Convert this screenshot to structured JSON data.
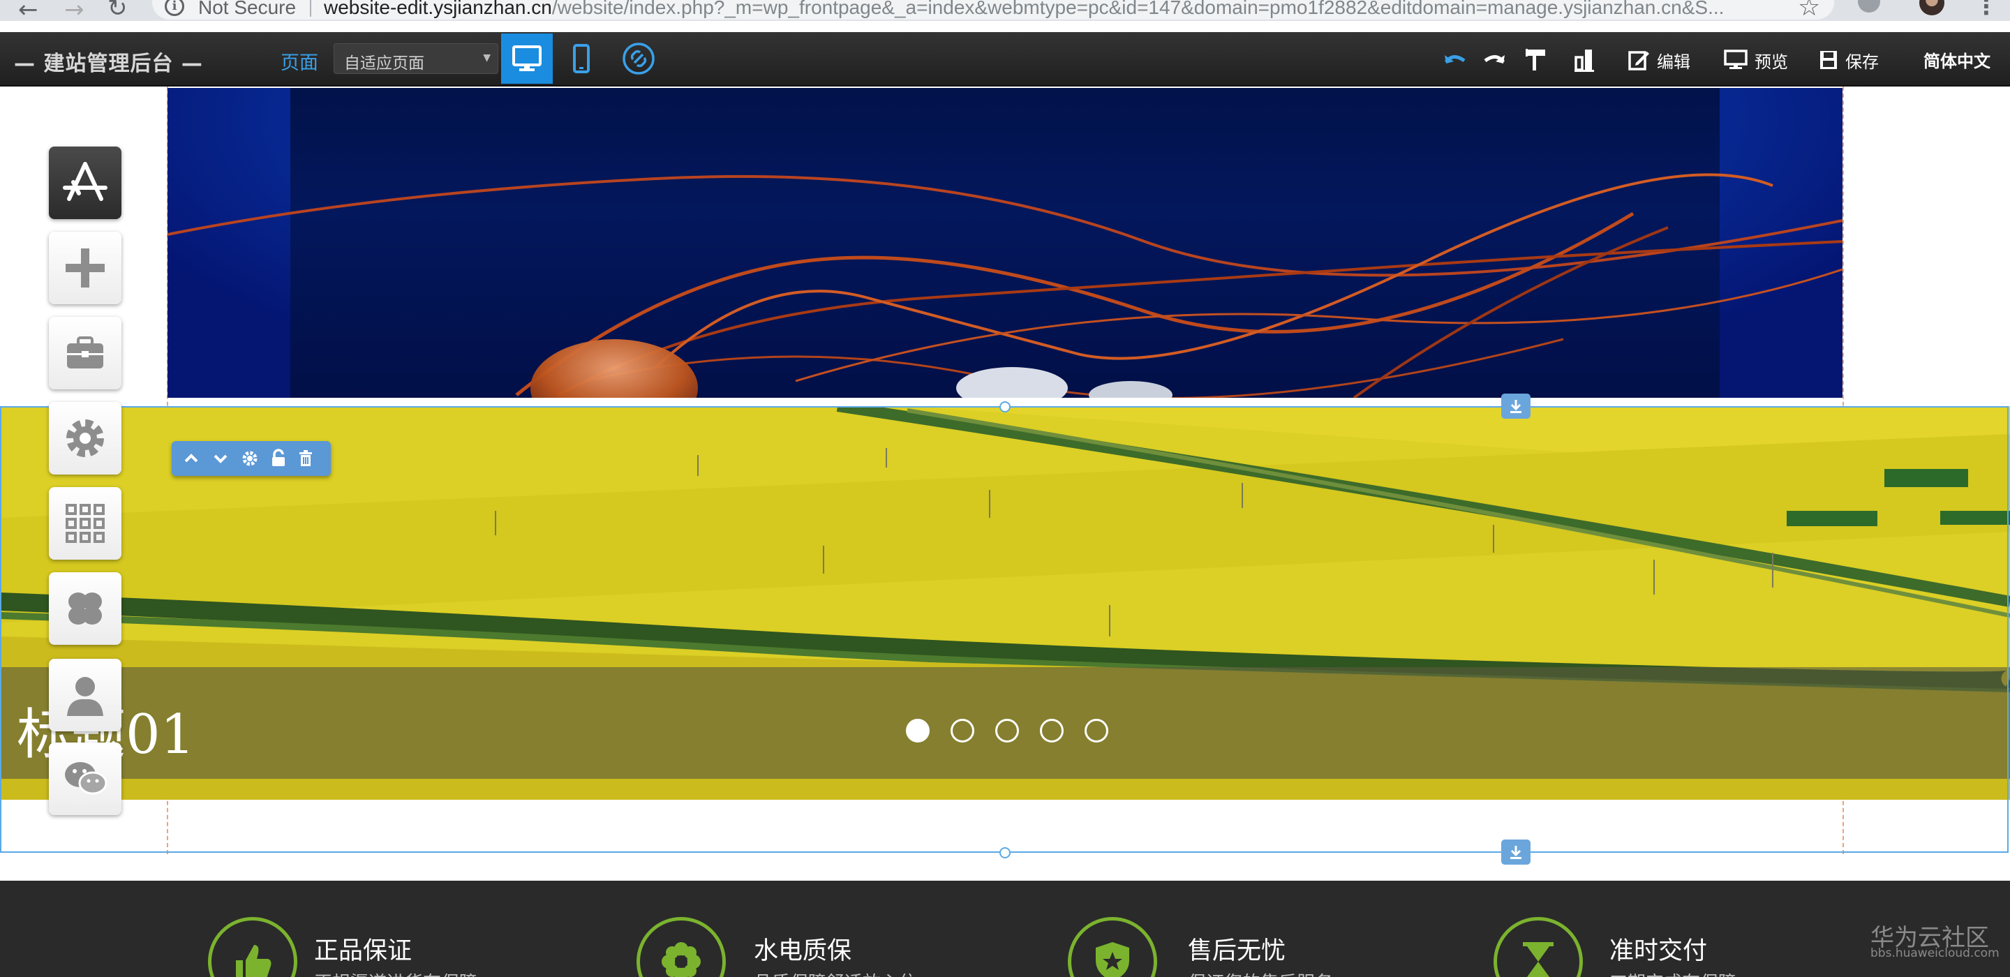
{
  "browser": {
    "security": "Not Secure",
    "url_host": "website-edit.ysjianzhan.cn",
    "url_path": "/website/index.php?_m=wp_frontpage&_a=index&webmtype=pc&id=147&domain=pmo1f2882&editdomain=manage.ysjianzhan.cn&S..."
  },
  "editor_toolbar": {
    "title": "— 建站管理后台 —",
    "page_label": "页面",
    "page_select_value": "自适应页面",
    "edit_label": "编辑",
    "preview_label": "预览",
    "save_label": "保存",
    "language": "简体中文",
    "active_device": "desktop"
  },
  "slideshow": {
    "caption": "标题01",
    "dots": 5,
    "active_dot": 1
  },
  "features": [
    {
      "title": "正品保证",
      "desc": "正规渠道进货有保障",
      "icon": "thumbs-up-icon"
    },
    {
      "title": "水电质保",
      "desc": "品质保障舒适放心住",
      "icon": "flower-icon"
    },
    {
      "title": "售后无忧",
      "desc": "保证您的售后服务",
      "icon": "shield-star-icon"
    },
    {
      "title": "准时交付",
      "desc": "工期完成有保障",
      "icon": "hourglass-icon"
    }
  ],
  "watermark": {
    "title": "华为云社区",
    "url": "bbs.huaweicloud.com"
  },
  "colors": {
    "accent": "#1a8de0",
    "selection": "#5aa9e6",
    "feature_green": "#7bb32e"
  }
}
